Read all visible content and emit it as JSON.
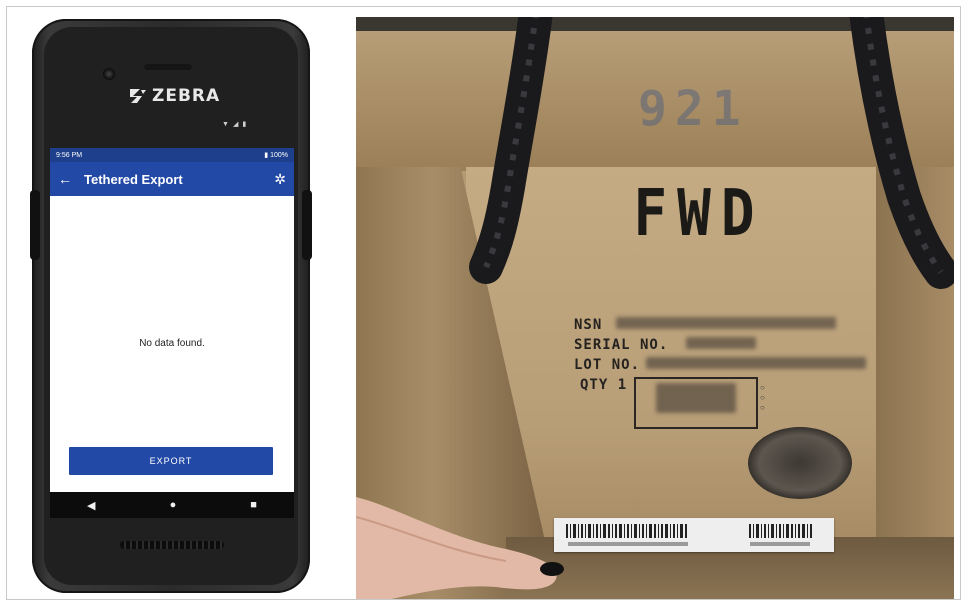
{
  "device": {
    "brand": "ZEBRA",
    "status_bar": {
      "time": "9:56 PM",
      "battery": "100%"
    },
    "app_bar": {
      "title": "Tethered Export"
    },
    "content": {
      "empty_message": "No data found."
    },
    "export_button": {
      "label": "EXPORT"
    }
  },
  "crate_photo": {
    "stamp_number": "921",
    "marking": "FWD",
    "stencil_lines": [
      "NSN",
      "SERIAL NO.",
      "LOT NO.",
      "QTY 1"
    ]
  },
  "colors": {
    "app_bar": "#2349a6",
    "status_bar": "#1d3f8c",
    "export_button": "#2349a6",
    "crate_wood": "#b49a74"
  }
}
